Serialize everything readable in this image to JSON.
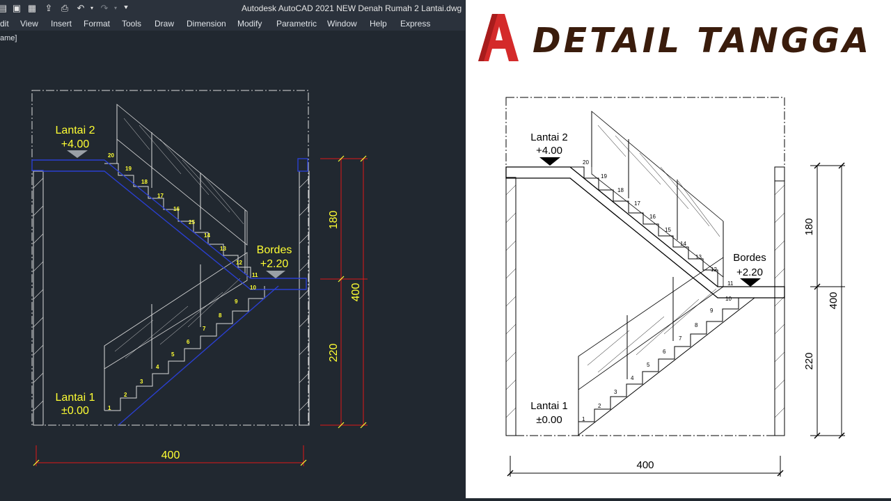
{
  "app": {
    "title": "Autodesk AutoCAD 2021    NEW Denah Rumah 2 Lantai.dwg",
    "quick_access": [
      "new-icon",
      "save-icon",
      "save-as-icon",
      "open-icon",
      "print-icon",
      "undo-icon",
      "redo-icon",
      "dropdown-icon"
    ]
  },
  "menu": [
    "dit",
    "View",
    "Insert",
    "Format",
    "Tools",
    "Draw",
    "Dimension",
    "Modify",
    "Parametric",
    "Window",
    "Help",
    "Express"
  ],
  "viewport": {
    "label": "ame]"
  },
  "cad_drawing": {
    "level_upper": {
      "name": "Lantai 2",
      "elev": "+4.00"
    },
    "level_landing": {
      "name": "Bordes",
      "elev": "+2.20"
    },
    "level_lower": {
      "name": "Lantai 1",
      "elev": "±0.00"
    },
    "dims": {
      "upper": "180",
      "lower": "220",
      "total": "400",
      "width": "400"
    },
    "step_numbers": [
      "1",
      "2",
      "3",
      "4",
      "5",
      "6",
      "7",
      "8",
      "9",
      "10",
      "11",
      "12",
      "13",
      "14",
      "25",
      "16",
      "17",
      "18",
      "19",
      "20"
    ],
    "colors": {
      "background": "#212830",
      "structure": "#dcdcdc",
      "highlight": "#2a3fcf",
      "text": "#ffff33",
      "dimension": "#e01818"
    }
  },
  "detail_panel": {
    "title": "DETAIL TANGGA",
    "logo_letter": "A",
    "level_upper": {
      "name": "Lantai 2",
      "elev": "+4.00"
    },
    "level_landing": {
      "name": "Bordes",
      "elev": "+2.20"
    },
    "level_lower": {
      "name": "Lantai 1",
      "elev": "±0.00"
    },
    "dims": {
      "upper": "180",
      "lower": "220",
      "total": "400",
      "width": "400"
    },
    "step_numbers": [
      "1",
      "2",
      "3",
      "4",
      "5",
      "6",
      "7",
      "8",
      "9",
      "10",
      "11",
      "12",
      "13",
      "14",
      "15",
      "16",
      "17",
      "18",
      "19",
      "20"
    ],
    "colors": {
      "background": "#ffffff",
      "line": "#000000",
      "title": "#3a1c0c",
      "logo": "#d42a2a"
    }
  }
}
